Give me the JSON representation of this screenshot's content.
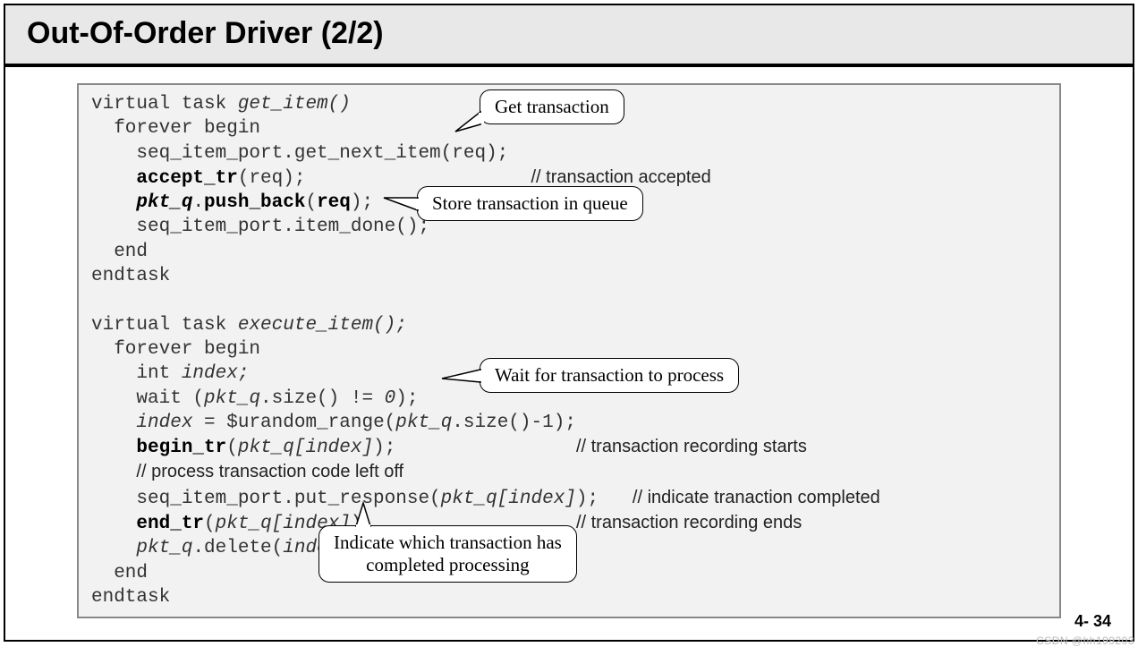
{
  "title": "Out-Of-Order Driver (2/2)",
  "code": {
    "l1a": "virtual task ",
    "l1b": "get_item()",
    "l2": "  forever begin",
    "l3": "    seq_item_port.get_next_item(req);",
    "l4a": "    ",
    "l4b": "accept_tr",
    "l4c": "(req);                    ",
    "l4cm": "// transaction accepted",
    "l5a": "    ",
    "l5b": "pkt_q",
    "l5c": ".",
    "l5d": "push_back",
    "l5e": "(",
    "l5f": "req",
    "l5g": ");",
    "l6": "    seq_item_port.item_done();",
    "l7": "  end",
    "l8": "endtask",
    "l9": "",
    "l10a": "virtual task ",
    "l10b": "execute_item();",
    "l11": "  forever begin",
    "l12a": "    int ",
    "l12b": "index;",
    "l13a": "    wait (",
    "l13b": "pkt_q",
    "l13c": ".size() != ",
    "l13d": "0",
    "l13e": ");",
    "l14a": "    ",
    "l14b": "index",
    "l14c": " = $urandom_range(",
    "l14d": "pkt_q",
    "l14e": ".size()-1);",
    "l15a": "    ",
    "l15b": "begin_tr",
    "l15c": "(",
    "l15d": "pkt_q[index]",
    "l15e": ");                ",
    "l15cm": "// transaction recording starts",
    "l16a": "    ",
    "l16cm": "// process transaction code left off",
    "l17a": "    seq_item_port.put_response(",
    "l17b": "pkt_q[index]",
    "l17c": ");   ",
    "l17cm": "// indicate tranaction completed",
    "l18a": "    ",
    "l18b": "end_tr",
    "l18c": "(",
    "l18d": "pkt_q[index]",
    "l18e": ");                  ",
    "l18cm": "// transaction recording ends",
    "l19a": "    ",
    "l19b": "pkt_q",
    "l19c": ".delete(",
    "l19d": "index",
    "l19e": ");",
    "l20": "  end",
    "l21": "endtask"
  },
  "callouts": {
    "c1": "Get transaction",
    "c2": "Store transaction in queue",
    "c3": "Wait for transaction to process",
    "c4a": "Indicate which transaction has",
    "c4b": "completed processing"
  },
  "page_num": "4- 34",
  "watermark": "CSDN @hh199203"
}
